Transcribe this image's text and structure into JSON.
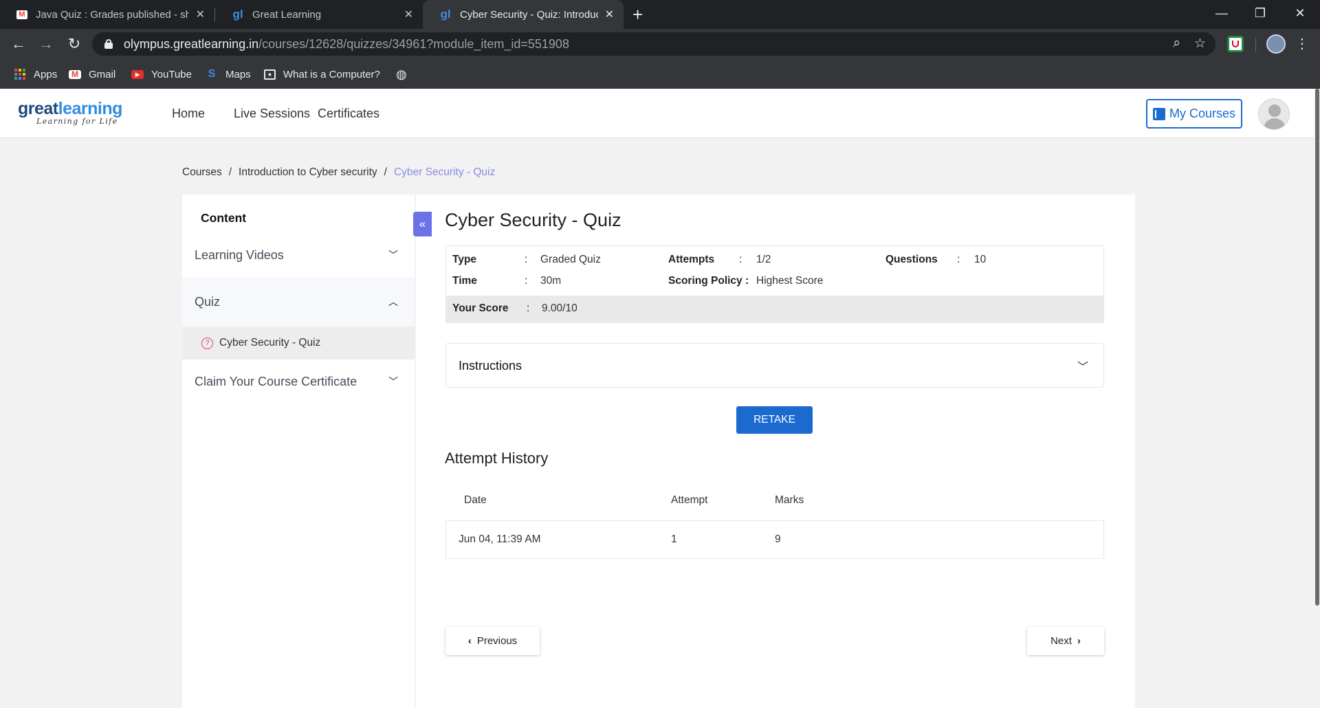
{
  "browser": {
    "tabs": [
      {
        "title": "Java Quiz : Grades published - sh",
        "icon": "gmail-icon",
        "active": false
      },
      {
        "title": "Great Learning",
        "icon": "greatlearning-icon",
        "active": false
      },
      {
        "title": "Cyber Security - Quiz: Introductio",
        "icon": "greatlearning-icon",
        "active": true
      }
    ],
    "url_host": "olympus.greatlearning.in",
    "url_path": "/courses/12628/quizzes/34961?module_item_id=551908",
    "bookmarks": [
      {
        "label": "Apps",
        "icon": "apps-grid-icon"
      },
      {
        "label": "Gmail",
        "icon": "gmail-icon"
      },
      {
        "label": "YouTube",
        "icon": "youtube-icon"
      },
      {
        "label": "Maps",
        "icon": "maps-icon"
      },
      {
        "label": "What is a Computer?",
        "icon": "page-icon"
      }
    ]
  },
  "site": {
    "logo_main_a": "great",
    "logo_main_b": "learning",
    "logo_tagline": "Learning for Life",
    "nav": [
      "Home",
      "Live Sessions",
      "Certificates"
    ],
    "my_courses": "My Courses"
  },
  "breadcrumb": {
    "items": [
      "Courses",
      "Introduction to Cyber security"
    ],
    "current": "Cyber Security - Quiz",
    "separator": "/"
  },
  "sidebar": {
    "title": "Content",
    "sections": [
      {
        "label": "Learning Videos",
        "expanded": false
      },
      {
        "label": "Quiz",
        "expanded": true
      },
      {
        "label": "Claim Your Course Certificate",
        "expanded": false
      }
    ],
    "quiz_item": "Cyber Security - Quiz"
  },
  "quiz": {
    "title": "Cyber Security - Quiz",
    "type_label": "Type",
    "type_value": "Graded Quiz",
    "time_label": "Time",
    "time_value": "30m",
    "attempts_label": "Attempts",
    "attempts_value": "1/2",
    "scoring_label": "Scoring Policy :",
    "scoring_value": "Highest Score",
    "questions_label": "Questions",
    "questions_value": "10",
    "score_label": "Your Score",
    "score_value": "9.00/10",
    "colon": ":"
  },
  "instructions": {
    "label": "Instructions"
  },
  "retake": "RETAKE",
  "history": {
    "title": "Attempt History",
    "columns": [
      "Date",
      "Attempt",
      "Marks"
    ],
    "rows": [
      {
        "date": "Jun 04, 11:39 AM",
        "attempt": "1",
        "marks": "9"
      }
    ]
  },
  "pager": {
    "previous": "Previous",
    "next": "Next"
  },
  "colors": {
    "accent": "#1b6ad0",
    "breadcrumb_current": "#8a8ae6",
    "collapse": "#6b72e8"
  }
}
